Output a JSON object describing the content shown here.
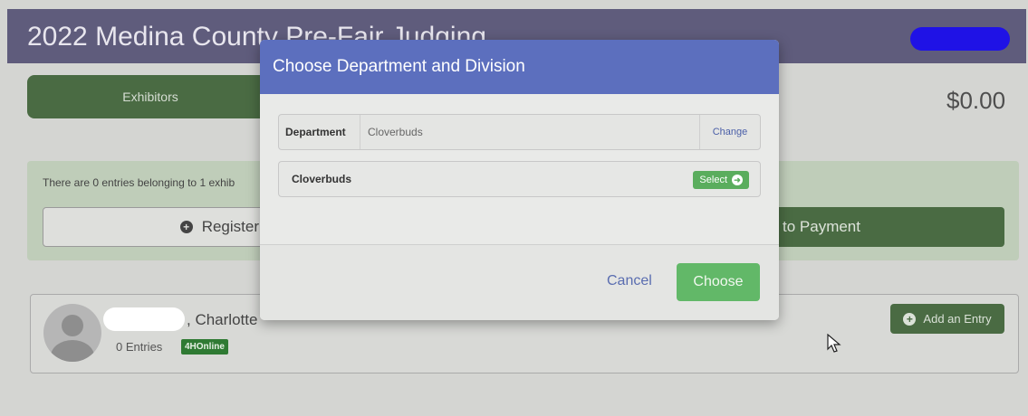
{
  "header": {
    "app_title": "2022 Medina County Pre-Fair Judging"
  },
  "nav": {
    "exhibitors_tab": "Exhibitors"
  },
  "cart": {
    "total": "$0.00"
  },
  "entries": {
    "summary": "There are 0 entries belonging to 1 exhib",
    "register_label": "Register",
    "payment_label": "to Payment"
  },
  "exhibitor": {
    "name": ", Charlotte",
    "entry_count": "0 Entries",
    "badge": "4HOnline",
    "add_entry_label": "Add an Entry"
  },
  "modal": {
    "title": "Choose Department and Division",
    "department_label": "Department",
    "department_value": "Cloverbuds",
    "change_label": "Change",
    "division_name": "Cloverbuds",
    "select_label": "Select",
    "cancel_label": "Cancel",
    "choose_label": "Choose"
  },
  "colors": {
    "header_bg": "#5f5c7c",
    "modal_header": "#5c6fbe",
    "primary_green": "#4a6b43",
    "select_green": "#5aad5d",
    "choose_green": "#62b868"
  },
  "icons": [
    "plus-circle-icon",
    "arrow-circle-right-icon",
    "user-avatar-icon",
    "mouse-pointer-icon"
  ]
}
